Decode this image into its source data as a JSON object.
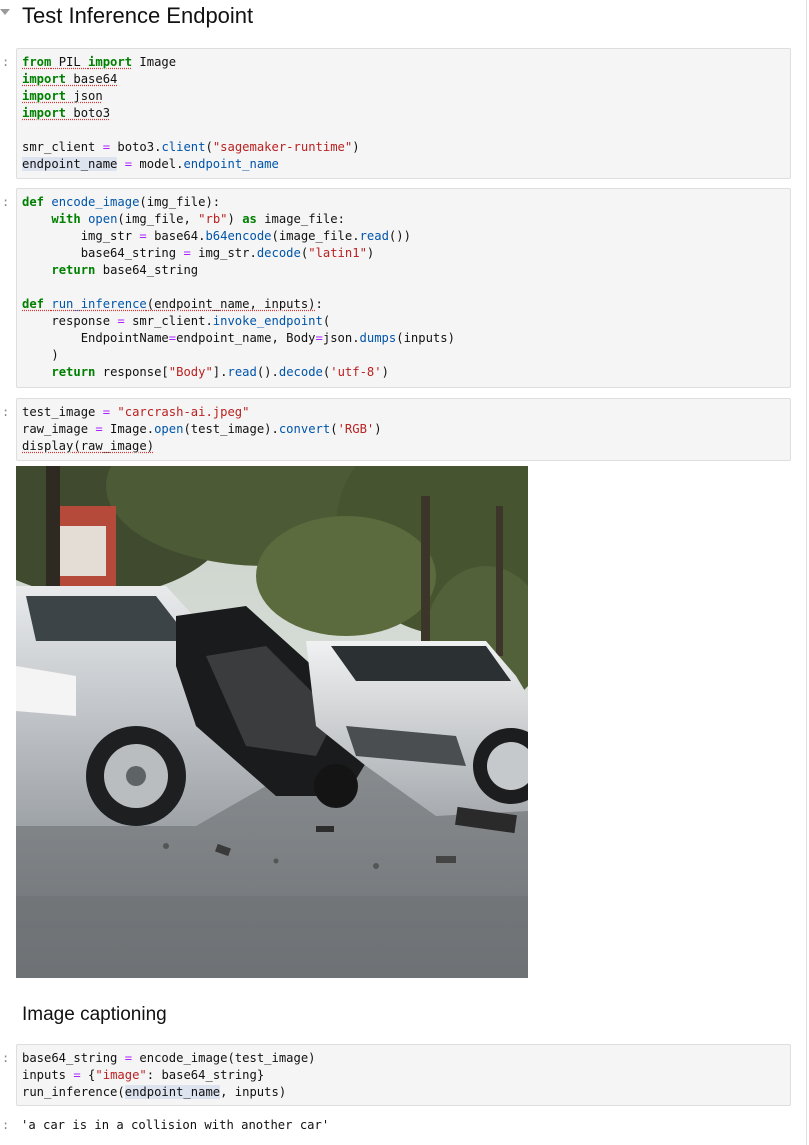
{
  "notebook": {
    "heading": "Test Inference Endpoint",
    "subheading": "Image captioning",
    "prompt_glyph": ":",
    "output_text": "'a car is in a collision with another car'",
    "image_alt": "carcrash-ai.jpeg",
    "cells": [
      {
        "id": "imports",
        "code": "from PIL import Image\nimport base64\nimport json\nimport boto3\n\nsmr_client = boto3.client(\"sagemaker-runtime\")\nendpoint_name = model.endpoint_name"
      },
      {
        "id": "functions",
        "code": "def encode_image(img_file):\n    with open(img_file, \"rb\") as image_file:\n        img_str = base64.b64encode(image_file.read())\n        base64_string = img_str.decode(\"latin1\")\n    return base64_string\n\ndef run_inference(endpoint_name, inputs):\n    response = smr_client.invoke_endpoint(\n        EndpointName=endpoint_name, Body=json.dumps(inputs)\n    )\n    return response[\"Body\"].read().decode('utf-8')"
      },
      {
        "id": "display-image",
        "code": "test_image = \"carcrash-ai.jpeg\"\nraw_image = Image.open(test_image).convert('RGB')\ndisplay(raw_image)"
      },
      {
        "id": "captioning",
        "code": "base64_string = encode_image(test_image)\ninputs = {\"image\": base64_string}\nrun_inference(endpoint_name, inputs)"
      }
    ]
  },
  "colors": {
    "keyword": "#008000",
    "string": "#ba2121",
    "function": "#0055aa",
    "operator": "#aa22ff",
    "cell_background": "#f5f5f5"
  }
}
